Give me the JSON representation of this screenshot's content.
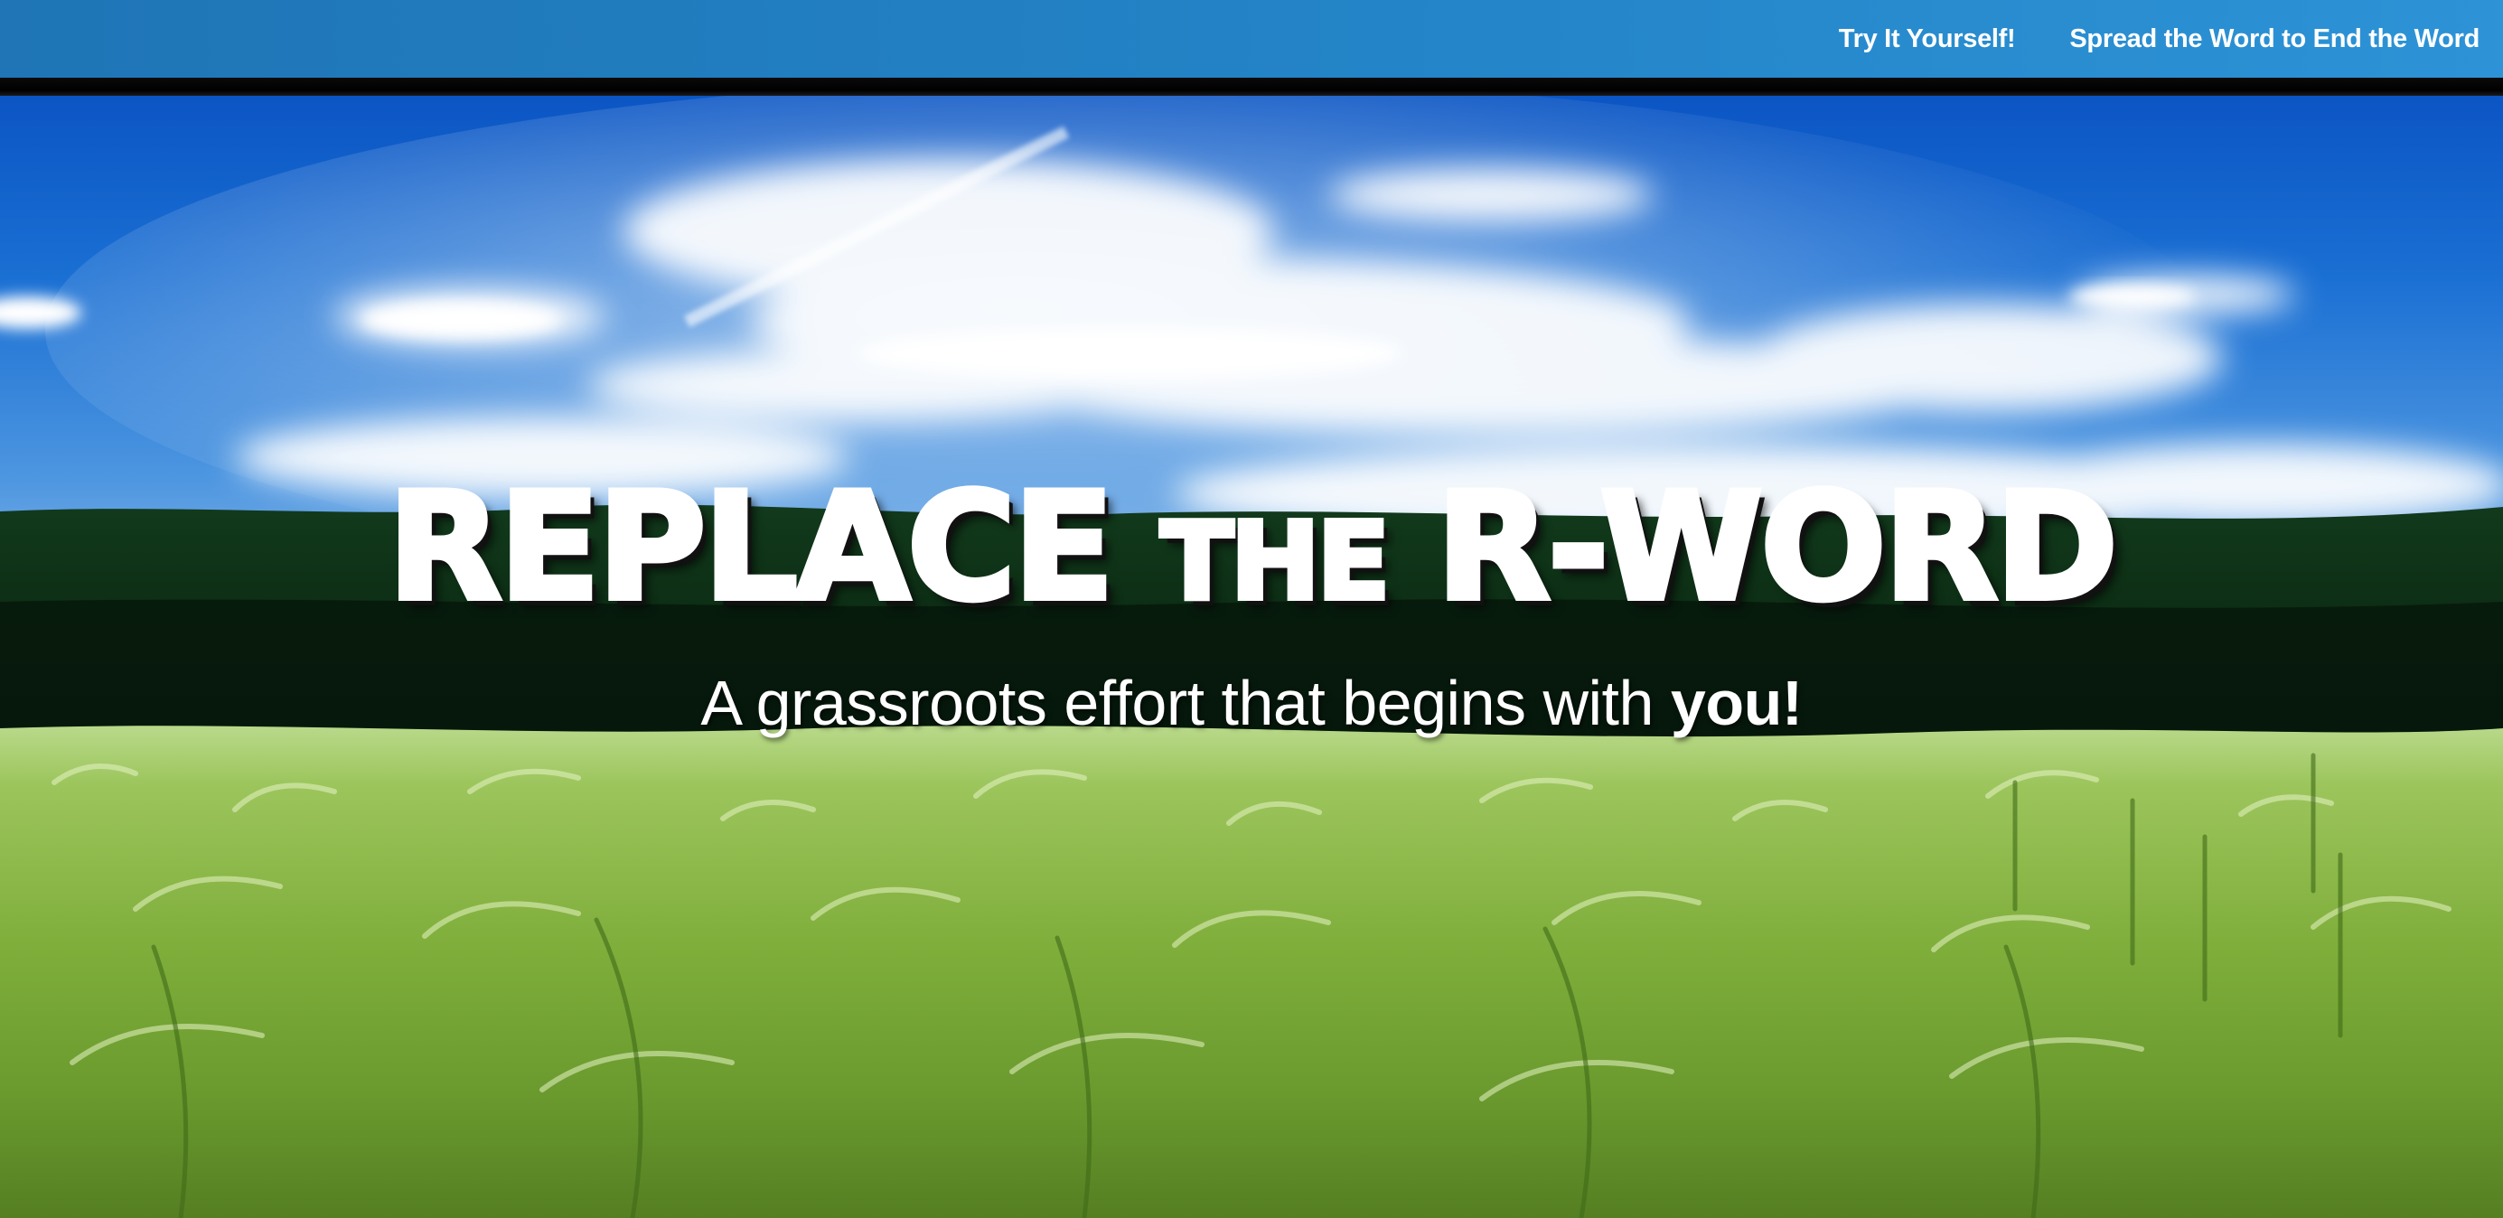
{
  "nav": {
    "links": [
      {
        "label": "Try It Yourself!"
      },
      {
        "label": "Spread the Word to End the Word"
      }
    ]
  },
  "hero": {
    "title_part1": "REPLACE",
    "title_part2": "THE",
    "title_part3": "R-WORD",
    "subtitle_text": "A grassroots effort that begins with",
    "subtitle_emphasis": "you!",
    "background": "sky-over-forest-and-wheat-field-photo"
  },
  "colors": {
    "nav_background": "#2384c7",
    "nav_text": "#ffffff",
    "divider": "#000000",
    "sky": "#1565c8",
    "forest": "#0d2410",
    "grass": "#8cc04a",
    "hero_text": "#ffffff"
  }
}
